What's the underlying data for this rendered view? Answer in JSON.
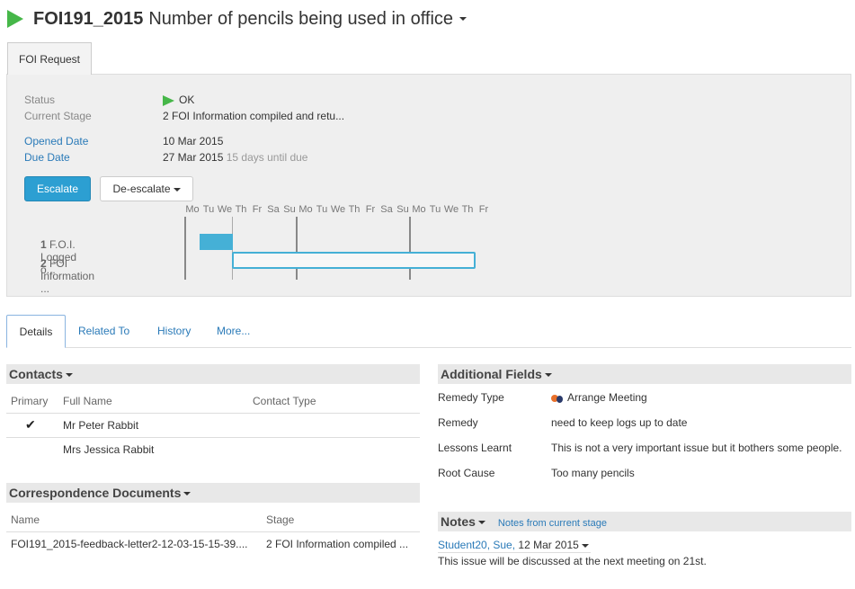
{
  "header": {
    "id": "FOI191_2015",
    "title": "Number of pencils being used in office"
  },
  "tab_main": "FOI Request",
  "summary": {
    "status_label": "Status",
    "status_value": "OK",
    "stage_label": "Current Stage",
    "stage_value": "2 FOI Information compiled and retu...",
    "opened_label": "Opened Date",
    "opened_value": "10 Mar 2015",
    "due_label": "Due Date",
    "due_value": "27 Mar 2015",
    "due_note": "15 days until due",
    "escalate_label": "Escalate",
    "deescalate_label": "De-escalate"
  },
  "gantt": {
    "days": [
      "Mo",
      "Tu",
      "We",
      "Th",
      "Fr",
      "Sa",
      "Su",
      "Mo",
      "Tu",
      "We",
      "Th",
      "Fr",
      "Sa",
      "Su",
      "Mo",
      "Tu",
      "We",
      "Th",
      "Fr"
    ],
    "rows": [
      {
        "num": "1",
        "label": "F.O.I. Logged o..."
      },
      {
        "num": "2",
        "label": "FOI Information ..."
      }
    ]
  },
  "subtabs": [
    "Details",
    "Related To",
    "History",
    "More..."
  ],
  "contacts": {
    "title": "Contacts",
    "columns": [
      "Primary",
      "Full Name",
      "Contact Type"
    ],
    "rows": [
      {
        "primary": "✔",
        "name": "Mr Peter Rabbit",
        "type": ""
      },
      {
        "primary": "",
        "name": "Mrs Jessica Rabbit",
        "type": ""
      }
    ]
  },
  "correspondence": {
    "title": "Correspondence Documents",
    "columns": [
      "Name",
      "Stage"
    ],
    "rows": [
      {
        "name": "FOI191_2015-feedback-letter2-12-03-15-15-39....",
        "stage": "2 FOI Information compiled ..."
      }
    ]
  },
  "additional": {
    "title": "Additional Fields",
    "rows": [
      {
        "label": "Remedy Type",
        "value": "Arrange Meeting"
      },
      {
        "label": "Remedy",
        "value": "need to keep logs up to date"
      },
      {
        "label": "Lessons Learnt",
        "value": "This is not a very important issue but it bothers some people."
      },
      {
        "label": "Root Cause",
        "value": "Too many pencils"
      }
    ]
  },
  "notes": {
    "title": "Notes",
    "filter_label": "Notes from current stage",
    "author": "Student20, Sue,",
    "date": "12 Mar 2015",
    "text": "This issue will be discussed at the next meeting on 21st."
  },
  "colors": {
    "accent": "#2a7ab8",
    "status_ok": "#46b749",
    "gantt_bar": "#45b0d6",
    "escalate_button": "#2c9fd2"
  }
}
